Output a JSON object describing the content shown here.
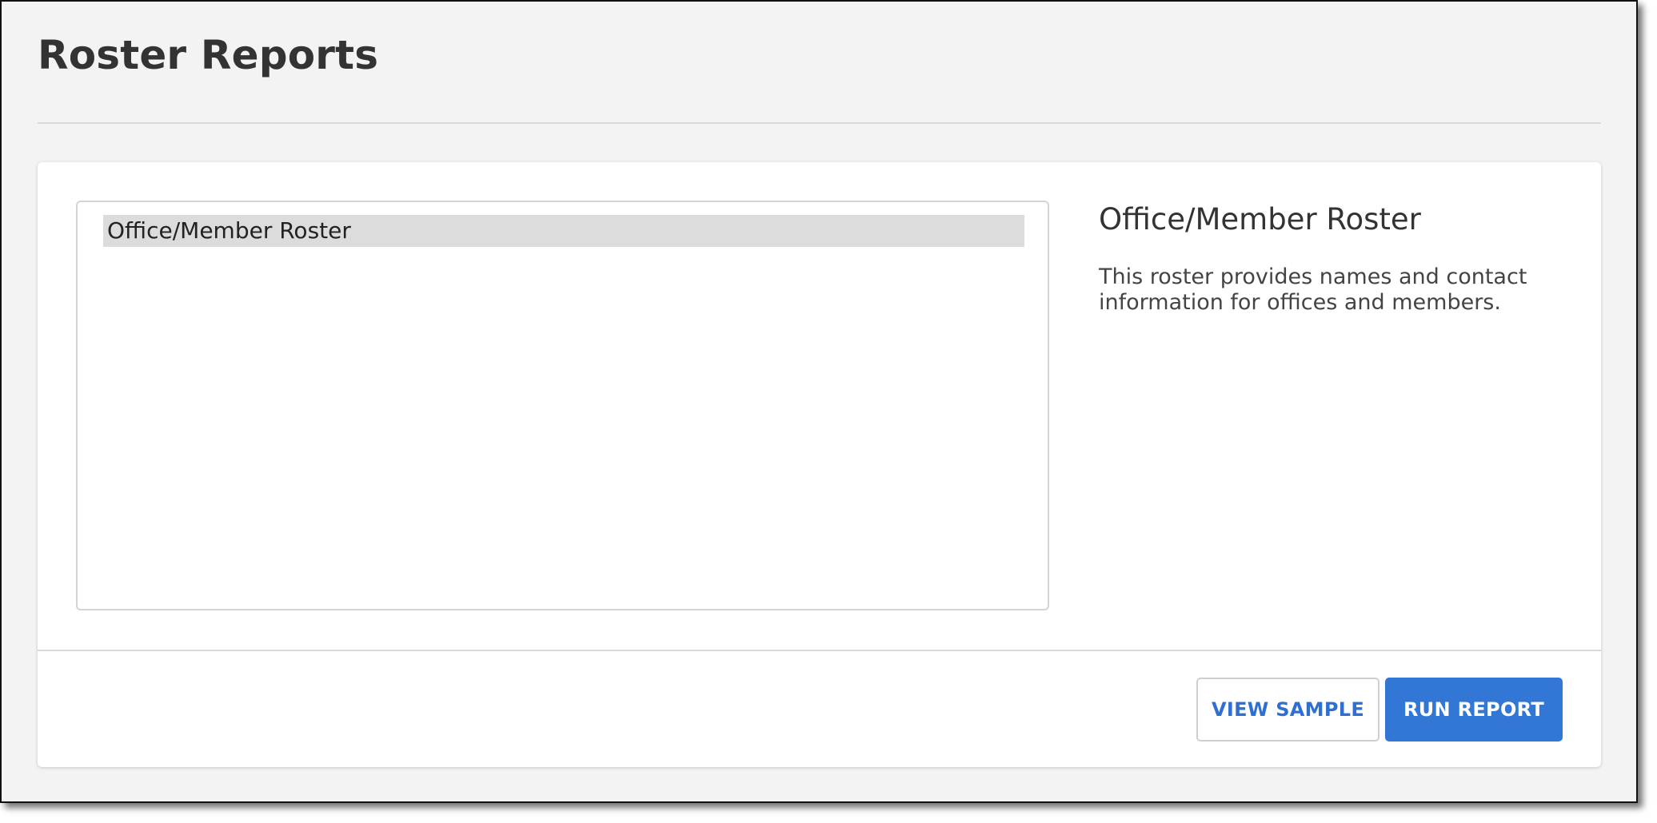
{
  "page": {
    "title": "Roster Reports"
  },
  "reports": {
    "items": [
      {
        "label": "Office/Member Roster",
        "selected": true
      }
    ]
  },
  "detail": {
    "title": "Office/Member Roster",
    "description": "This roster provides names and contact information for offices and members."
  },
  "actions": {
    "view_sample_label": "VIEW SAMPLE",
    "run_report_label": "RUN REPORT"
  },
  "colors": {
    "accent": "#3276d6",
    "selected_item_bg": "#dcdcdc",
    "page_bg": "#f3f3f3"
  }
}
